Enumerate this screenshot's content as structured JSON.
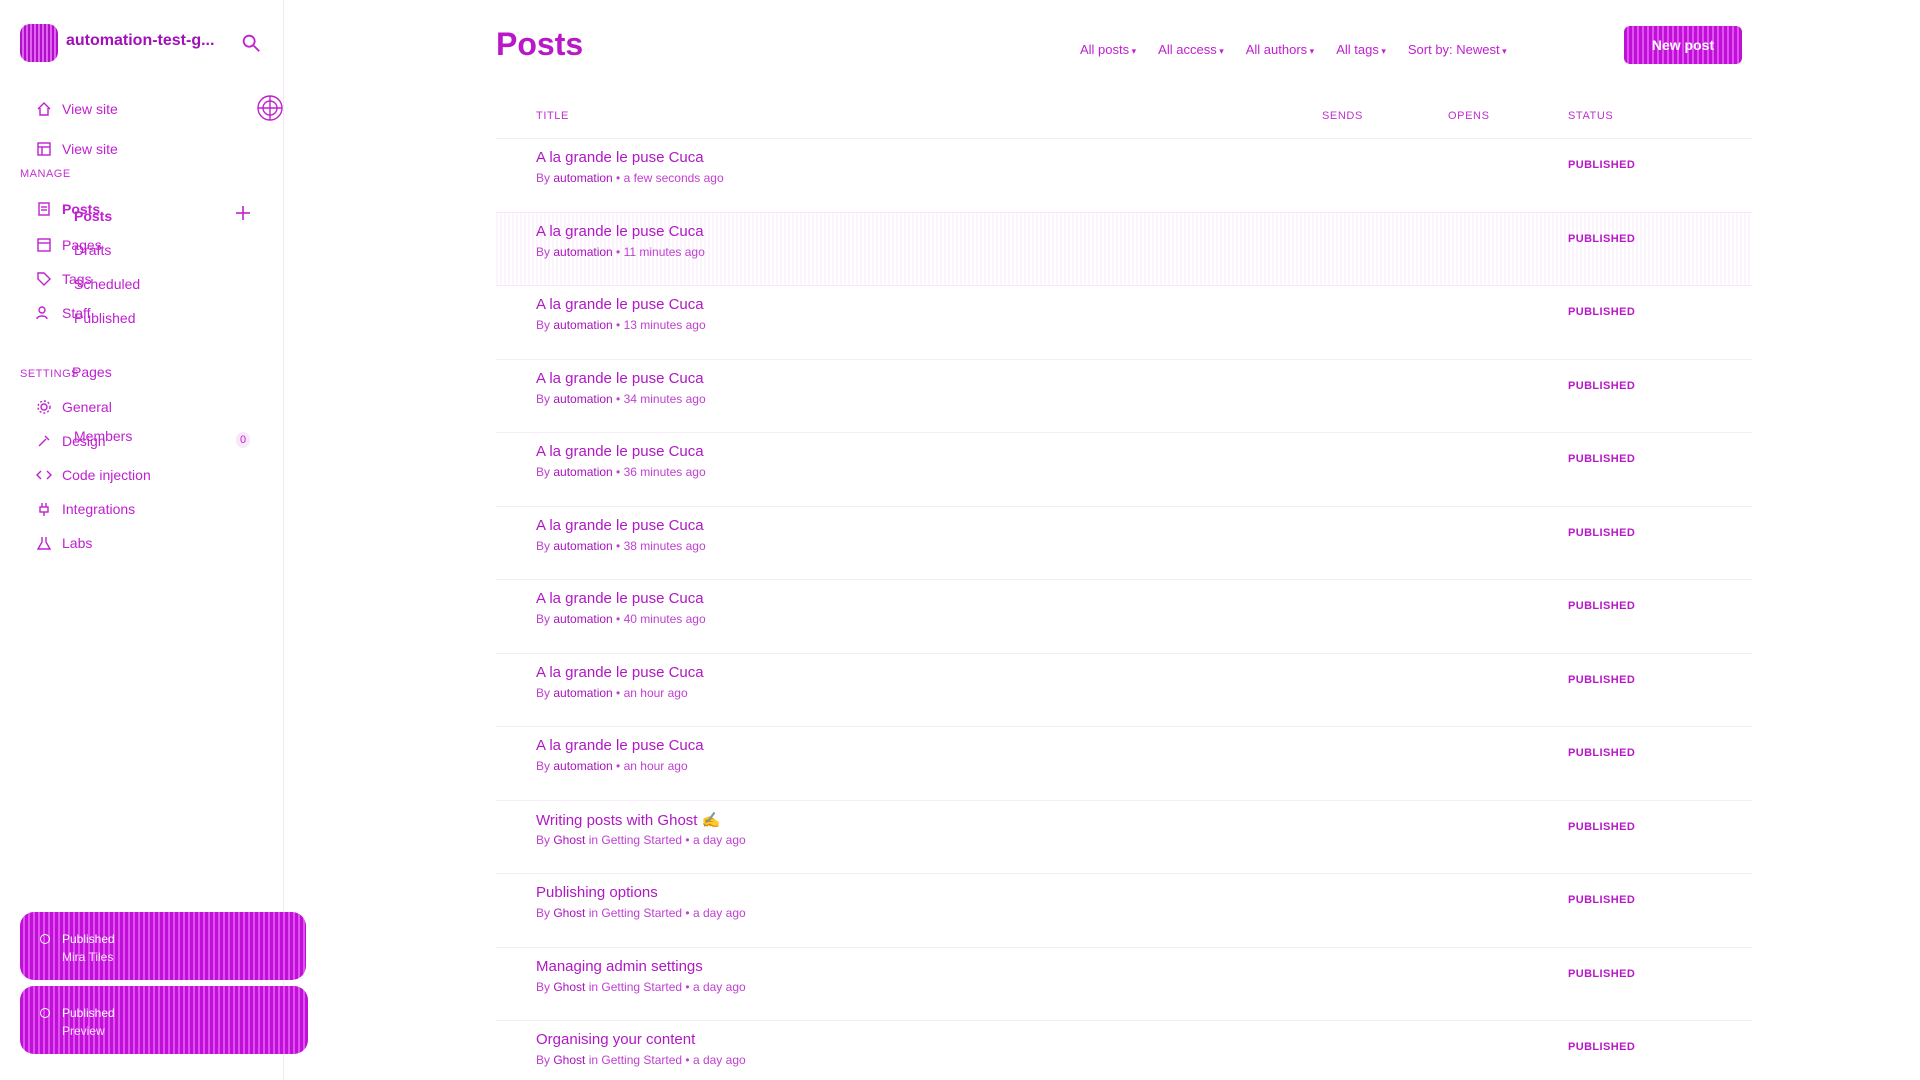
{
  "sidebar": {
    "site_title": "automation-test-g...",
    "items": [
      {
        "label": "View site",
        "icon": "home-icon"
      },
      {
        "label": "View site",
        "icon": "layout-icon"
      }
    ],
    "manage_label": "MANAGE",
    "manage_items": [
      {
        "label": "Posts",
        "icon": "posts-icon"
      },
      {
        "label": "Pages",
        "icon": "pages-icon"
      },
      {
        "label": "Tags",
        "icon": "tag-icon"
      },
      {
        "label": "Staff",
        "icon": "staff-icon"
      }
    ],
    "posts_sub": [
      "Posts",
      "Drafts",
      "Scheduled",
      "Published"
    ],
    "settings_label": "SETTINGS",
    "settings_items": [
      {
        "label": "General",
        "icon": "gear-icon"
      },
      {
        "label": "Design",
        "icon": "brush-icon"
      },
      {
        "label": "Code injection",
        "icon": "code-icon"
      },
      {
        "label": "Integrations",
        "icon": "plug-icon"
      },
      {
        "label": "Labs",
        "icon": "flask-icon"
      }
    ],
    "pages_label": "Pages",
    "members_label": "Members",
    "members_count": "0",
    "pill_1": {
      "line1": "Published",
      "line2": "Mira Tiles"
    },
    "pill_2": {
      "line1": "Published",
      "line2": "Preview"
    }
  },
  "header": {
    "title": "Posts",
    "filters": [
      "All posts",
      "All access",
      "All authors",
      "All tags",
      "Sort by: Newest"
    ],
    "new_post_label": "New post"
  },
  "columns": {
    "title": "TITLE",
    "sends": "SENDS",
    "opens": "OPENS",
    "status": "STATUS"
  },
  "posts": [
    {
      "title": "A la grande le puse Cuca",
      "author": "automation",
      "meta": " • a few seconds ago",
      "status": "PUBLISHED"
    },
    {
      "title": "A la grande le puse Cuca",
      "author": "automation",
      "meta": " • 11 minutes ago",
      "status": "PUBLISHED"
    },
    {
      "title": "A la grande le puse Cuca",
      "author": "automation",
      "meta": " • 13 minutes ago",
      "status": "PUBLISHED"
    },
    {
      "title": "A la grande le puse Cuca",
      "author": "automation",
      "meta": " • 34 minutes ago",
      "status": "PUBLISHED"
    },
    {
      "title": "A la grande le puse Cuca",
      "author": "automation",
      "meta": " • 36 minutes ago",
      "status": "PUBLISHED"
    },
    {
      "title": "A la grande le puse Cuca",
      "author": "automation",
      "meta": " • 38 minutes ago",
      "status": "PUBLISHED"
    },
    {
      "title": "A la grande le puse Cuca",
      "author": "automation",
      "meta": " • 40 minutes ago",
      "status": "PUBLISHED"
    },
    {
      "title": "A la grande le puse Cuca",
      "author": "automation",
      "meta": " • an hour ago",
      "status": "PUBLISHED"
    },
    {
      "title": "A la grande le puse Cuca",
      "author": "automation",
      "meta": " • an hour ago",
      "status": "PUBLISHED"
    },
    {
      "title": "Writing posts with Ghost ✍️",
      "author": "Ghost",
      "meta": " in Getting Started • a day ago",
      "status": "PUBLISHED"
    },
    {
      "title": "Publishing options",
      "author": "Ghost",
      "meta": " in Getting Started • a day ago",
      "status": "PUBLISHED"
    },
    {
      "title": "Managing admin settings",
      "author": "Ghost",
      "meta": " in Getting Started • a day ago",
      "status": "PUBLISHED"
    },
    {
      "title": "Organising your content",
      "author": "Ghost",
      "meta": " in Getting Started • a day ago",
      "status": "PUBLISHED"
    }
  ],
  "colors": {
    "accent": "#c020d0",
    "accent_dark": "#a010b8"
  }
}
